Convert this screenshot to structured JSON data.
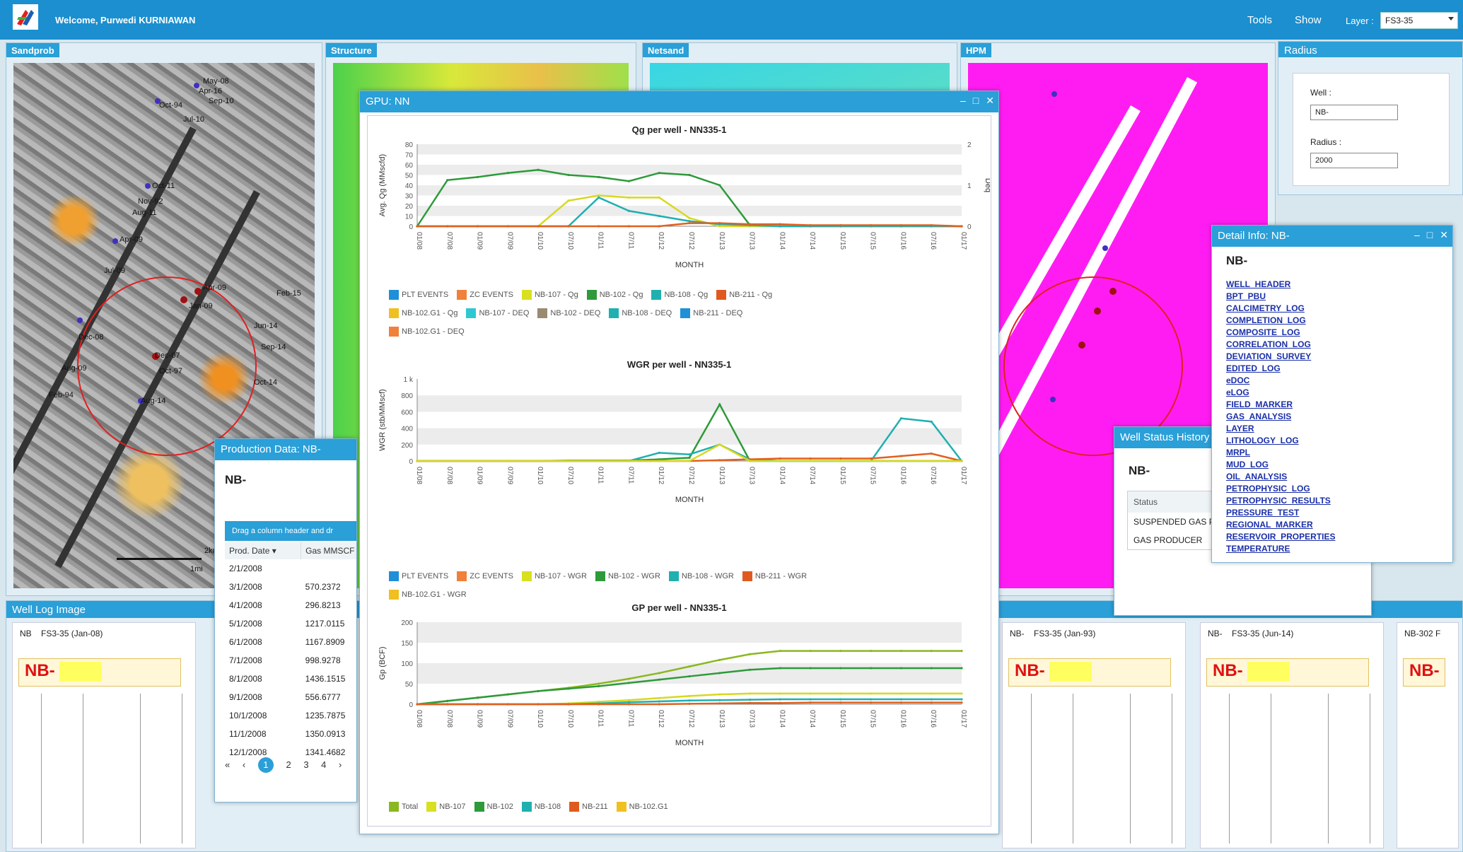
{
  "header": {
    "welcome": "Welcome, Purwedi KURNIAWAN",
    "menu": [
      "Tools",
      "Show"
    ],
    "layer_label": "Layer :",
    "layer_value": "FS3-35"
  },
  "panels": {
    "sandprob": "Sandprob",
    "structure": "Structure",
    "netsand": "Netsand",
    "hpm": "HPM",
    "radius": "Radius",
    "well_log": "Well Log Image"
  },
  "map_labels": [
    "May-08",
    "Apr-16",
    "Sep-10",
    "Oct-94",
    "Jul-10",
    "Oct-11",
    "Nov-92",
    "Aug-11",
    "Apr-09",
    "Jul-09",
    "Apr-09",
    "Jan-09",
    "Dec-08",
    "Dec-07",
    "Oct-97",
    "Aug-09",
    "Aug-14",
    "Feb-94",
    "Jun-14",
    "Sep-14",
    "Oct-14",
    "Feb-15",
    "Jan-03"
  ],
  "scale": {
    "km": "2km",
    "mi": "1mi"
  },
  "radius_form": {
    "well_label": "Well :",
    "well_value": "NB-",
    "radius_label": "Radius :",
    "radius_value": "2000"
  },
  "gpu_window": {
    "title": "GPU: NN",
    "charts": [
      {
        "title": "Qg per well - NN335-1",
        "ylabel": "Avg. Qg (MMscfd)",
        "y2label": "Deq",
        "xlabel": "MONTH",
        "yticks": [
          "0",
          "10",
          "20",
          "30",
          "40",
          "50",
          "60",
          "70",
          "80"
        ],
        "y2ticks": [
          "0",
          "1",
          "2"
        ],
        "legend": [
          "PLT EVENTS",
          "ZC EVENTS",
          "NB-107 - Qg",
          "NB-102 - Qg",
          "NB-108 - Qg",
          "NB-211 - Qg",
          "NB-102.G1 - Qg",
          "NB-107 - DEQ",
          "NB-102 - DEQ",
          "NB-108 - DEQ",
          "NB-211 - DEQ",
          "NB-102.G1 - DEQ"
        ]
      },
      {
        "title": "WGR per well - NN335-1",
        "ylabel": "WGR (stb/MMscf)",
        "xlabel": "MONTH",
        "yticks": [
          "0",
          "200",
          "400",
          "600",
          "800",
          "1 k"
        ],
        "legend": [
          "PLT EVENTS",
          "ZC EVENTS",
          "NB-107 - WGR",
          "NB-102 - WGR",
          "NB-108 - WGR",
          "NB-211 - WGR",
          "NB-102.G1 - WGR"
        ]
      },
      {
        "title": "GP per well - NN335-1",
        "ylabel": "Gp (BCF)",
        "xlabel": "MONTH",
        "yticks": [
          "0",
          "50",
          "100",
          "150",
          "200"
        ],
        "legend": [
          "Total",
          "NB-107",
          "NB-102",
          "NB-108",
          "NB-211",
          "NB-102.G1"
        ]
      }
    ],
    "xticks": [
      "01/08",
      "07/08",
      "01/09",
      "07/09",
      "01/10",
      "07/10",
      "01/11",
      "07/11",
      "01/12",
      "07/12",
      "01/13",
      "07/13",
      "01/14",
      "07/14",
      "01/15",
      "07/15",
      "01/16",
      "07/16",
      "01/17"
    ]
  },
  "chart_data": [
    {
      "type": "line",
      "title": "Qg per well - NN335-1",
      "xlabel": "MONTH",
      "ylabel": "Avg. Qg (MMscfd)",
      "ylim": [
        0,
        80
      ],
      "x": [
        "01/08",
        "07/08",
        "01/09",
        "07/09",
        "01/10",
        "07/10",
        "01/11",
        "07/11",
        "01/12",
        "07/12",
        "01/13",
        "07/13",
        "01/14",
        "07/14",
        "01/15",
        "07/15",
        "01/16",
        "07/16",
        "01/17"
      ],
      "series": [
        {
          "name": "NB-102 - Qg",
          "color": "#2e9a3a",
          "values": [
            0,
            45,
            48,
            52,
            55,
            50,
            48,
            44,
            52,
            50,
            40,
            1,
            0,
            0,
            0,
            0,
            0,
            0,
            0
          ]
        },
        {
          "name": "NB-107 - Qg",
          "color": "#d8d820",
          "values": [
            0,
            0,
            0,
            0,
            0,
            25,
            30,
            28,
            28,
            8,
            0,
            0,
            0,
            0,
            0,
            0,
            0,
            0,
            0
          ]
        },
        {
          "name": "NB-108 - Qg",
          "color": "#20b0b0",
          "values": [
            0,
            0,
            0,
            0,
            0,
            0,
            28,
            15,
            10,
            5,
            2,
            1,
            0,
            0,
            0,
            0,
            0,
            0,
            0
          ]
        },
        {
          "name": "NB-211 - Qg",
          "color": "#e06020",
          "values": [
            0,
            0,
            0,
            0,
            0,
            0,
            0,
            0,
            0,
            3,
            3,
            2,
            2,
            1,
            1,
            1,
            1,
            1,
            0
          ]
        }
      ]
    },
    {
      "type": "line",
      "title": "WGR per well - NN335-1",
      "xlabel": "MONTH",
      "ylabel": "WGR (stb/MMscf)",
      "ylim": [
        0,
        1000
      ],
      "x": [
        "01/08",
        "07/08",
        "01/09",
        "07/09",
        "01/10",
        "07/10",
        "01/11",
        "07/11",
        "01/12",
        "07/12",
        "01/13",
        "07/13",
        "01/14",
        "07/14",
        "01/15",
        "07/15",
        "01/16",
        "07/16",
        "01/17"
      ],
      "series": [
        {
          "name": "NB-102 - WGR",
          "color": "#2e9a3a",
          "values": [
            0,
            0,
            0,
            0,
            0,
            5,
            5,
            5,
            20,
            40,
            690,
            0,
            0,
            0,
            0,
            0,
            0,
            0,
            0
          ]
        },
        {
          "name": "NB-108 - WGR",
          "color": "#20b0b0",
          "values": [
            0,
            0,
            0,
            0,
            0,
            0,
            0,
            0,
            100,
            80,
            200,
            20,
            0,
            0,
            0,
            0,
            520,
            480,
            0
          ]
        },
        {
          "name": "NB-211 - WGR",
          "color": "#e06020",
          "values": [
            0,
            0,
            0,
            0,
            0,
            0,
            0,
            0,
            0,
            0,
            10,
            20,
            30,
            30,
            30,
            30,
            60,
            90,
            0
          ]
        },
        {
          "name": "NB-107 - WGR",
          "color": "#d8d820",
          "values": [
            0,
            0,
            0,
            0,
            0,
            0,
            0,
            0,
            0,
            0,
            200,
            0,
            0,
            0,
            0,
            0,
            0,
            0,
            0
          ]
        }
      ]
    },
    {
      "type": "line",
      "title": "GP per well - NN335-1",
      "xlabel": "MONTH",
      "ylabel": "Gp (BCF)",
      "ylim": [
        0,
        200
      ],
      "x": [
        "01/08",
        "07/08",
        "01/09",
        "07/09",
        "01/10",
        "07/10",
        "01/11",
        "07/11",
        "01/12",
        "07/12",
        "01/13",
        "07/13",
        "01/14",
        "07/14",
        "01/15",
        "07/15",
        "01/16",
        "07/16",
        "01/17"
      ],
      "series": [
        {
          "name": "Total",
          "color": "#8ab820",
          "values": [
            0,
            8,
            16,
            24,
            32,
            40,
            50,
            62,
            76,
            92,
            108,
            122,
            130,
            130,
            130,
            130,
            130,
            130,
            130
          ]
        },
        {
          "name": "NB-102",
          "color": "#2e9a3a",
          "values": [
            0,
            8,
            16,
            24,
            32,
            38,
            44,
            52,
            60,
            68,
            76,
            84,
            88,
            88,
            88,
            88,
            88,
            88,
            88
          ]
        },
        {
          "name": "NB-107",
          "color": "#d8d820",
          "values": [
            0,
            0,
            0,
            0,
            0,
            2,
            6,
            10,
            15,
            20,
            24,
            26,
            26,
            26,
            26,
            26,
            26,
            26,
            26
          ]
        },
        {
          "name": "NB-108",
          "color": "#20b0b0",
          "values": [
            0,
            0,
            0,
            0,
            0,
            0,
            2,
            5,
            7,
            9,
            10,
            11,
            12,
            12,
            12,
            12,
            12,
            12,
            12
          ]
        },
        {
          "name": "NB-211",
          "color": "#e06020",
          "values": [
            0,
            0,
            0,
            0,
            0,
            0,
            0,
            0,
            0,
            1,
            2,
            3,
            3,
            4,
            4,
            4,
            4,
            4,
            4
          ]
        }
      ]
    }
  ],
  "production": {
    "title": "Production Data: NB-",
    "well": "NB-",
    "group_hint": "Drag a column header and dr",
    "columns": [
      "Prod. Date",
      "Gas MMSCF"
    ],
    "rows": [
      [
        "2/1/2008",
        ""
      ],
      [
        "3/1/2008",
        "570.2372"
      ],
      [
        "4/1/2008",
        "296.8213"
      ],
      [
        "5/1/2008",
        "1217.0115"
      ],
      [
        "6/1/2008",
        "1167.8909"
      ],
      [
        "7/1/2008",
        "998.9278"
      ],
      [
        "8/1/2008",
        "1436.1515"
      ],
      [
        "9/1/2008",
        "556.6777"
      ],
      [
        "10/1/2008",
        "1235.7875"
      ],
      [
        "11/1/2008",
        "1350.0913"
      ],
      [
        "12/1/2008",
        "1341.4682"
      ]
    ],
    "pages": [
      "1",
      "2",
      "3",
      "4"
    ]
  },
  "detail_info": {
    "title": "Detail Info: NB-",
    "well": "NB-",
    "items": [
      "WELL_HEADER",
      "BPT_PBU",
      "CALCIMETRY_LOG",
      "COMPLETION_LOG",
      "COMPOSITE_LOG",
      "CORRELATION_LOG",
      "DEVIATION_SURVEY",
      "EDITED_LOG",
      "eDOC",
      "eLOG",
      "FIELD_MARKER",
      "GAS_ANALYSIS",
      "LAYER",
      "LITHOLOGY_LOG",
      "MRPL",
      "MUD_LOG",
      "OIL_ANALYSIS",
      "PETROPHYSIC_LOG",
      "PETROPHYSIC_RESULTS",
      "PRESSURE_TEST",
      "REGIONAL_MARKER",
      "RESERVOIR_PROPERTIES",
      "TEMPERATURE"
    ]
  },
  "well_status": {
    "title": "Well Status History",
    "well": "NB-",
    "column": "Status",
    "rows": [
      "SUSPENDED GAS PI",
      "GAS PRODUCER"
    ]
  },
  "well_logs": [
    {
      "well": "NB",
      "layer": "FS3-35 (Jan-08)",
      "label": "NB-"
    },
    {
      "well": "NB-",
      "layer": "FS3-35 (Jan-93)",
      "label": "NB-"
    },
    {
      "well": "NB-",
      "layer": "FS3-35 (Jun-14)",
      "label": "NB-"
    },
    {
      "well": "NB-302 F",
      "layer": "",
      "label": "NB-"
    }
  ]
}
